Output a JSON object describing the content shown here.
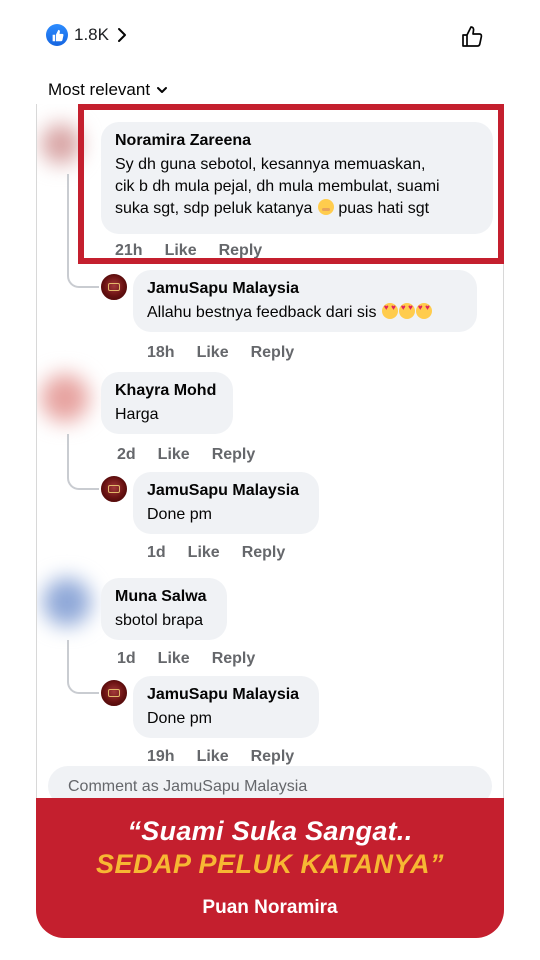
{
  "reactions": {
    "count": "1.8K",
    "icon": "like-badge-icon",
    "color": "#1877f2"
  },
  "sort": {
    "label": "Most relevant"
  },
  "comments": [
    {
      "name": "Noramira Zareena",
      "lines": [
        "Sy dh guna sebotol, kesannya memuaskan,",
        "cik b dh mula pejal, dh mula membulat, suami",
        "suka sgt, sdp peluk katanya",
        "puas hati sgt"
      ],
      "time": "21h",
      "like": "Like",
      "reply": "Reply"
    },
    {
      "name": "JamuSapu Malaysia",
      "text": "Allahu bestnya feedback dari sis",
      "time": "18h",
      "like": "Like",
      "reply": "Reply"
    },
    {
      "name": "Khayra Mohd",
      "text": "Harga",
      "time": "2d",
      "like": "Like",
      "reply": "Reply"
    },
    {
      "name": "JamuSapu Malaysia",
      "text": "Done pm",
      "time": "1d",
      "like": "Like",
      "reply": "Reply"
    },
    {
      "name": "Muna Salwa",
      "text": "sbotol brapa",
      "time": "1d",
      "like": "Like",
      "reply": "Reply"
    },
    {
      "name": "JamuSapu Malaysia",
      "text": "Done pm",
      "time": "19h",
      "like": "Like",
      "reply": "Reply"
    }
  ],
  "composer": {
    "placeholder": "Comment as JamuSapu Malaysia"
  },
  "banner": {
    "quote_line1": "“Suami Suka Sangat..",
    "quote_line2": "SEDAP PELUK KATANYA”",
    "author": "Puan Noramira",
    "background": "#c41f2e",
    "accent": "#f7b733"
  }
}
